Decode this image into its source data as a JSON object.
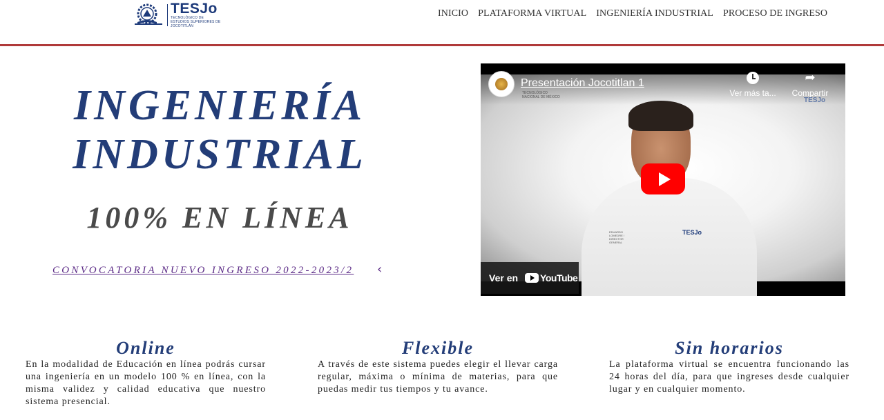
{
  "header": {
    "logo_title": "TESJo",
    "logo_subtitle": "TECNOLÓGICO DE ESTUDIOS SUPERIORES DE JOCOTITLÁN",
    "nav": [
      {
        "label": "INICIO"
      },
      {
        "label": "PLATAFORMA VIRTUAL"
      },
      {
        "label": "INGENIERÍA INDUSTRIAL"
      },
      {
        "label": "PROCESO DE INGRESO"
      }
    ],
    "accent_line_color": "#b03a3a"
  },
  "hero": {
    "title_line1": "INGENIERÍA",
    "title_line2": "INDUSTRIAL",
    "subtitle": "100% EN LÍNEA",
    "cta_label": "CONVOCATORIA NUEVO INGRESO 2022-2023/2",
    "cta_icon": "chevron-left-icon",
    "title_color": "#233d78"
  },
  "video": {
    "title": "Presentación Jocotitlan 1",
    "channel_caption": "TECNOLÓGICO NACIONAL DE MÉXICO",
    "watch_later_label": "Ver más ta...",
    "share_label": "Compartir",
    "watch_on_label": "Ver en",
    "youtube_word": "YouTube",
    "corner_mark": "TESJo",
    "shirt_logo": "TESJo",
    "shirt_name": "EDUARDO LOMEDRE / DIRECTOR GENERAL",
    "play_color": "#ff0000"
  },
  "features": [
    {
      "title": "Online",
      "text": "En la modalidad de Educación en línea podrás cursar una ingeniería en un modelo 100 % en línea, con la misma validez y calidad educativa que nuestro sistema presencial."
    },
    {
      "title": "Flexible",
      "text": "A través de este sistema puedes elegir el llevar carga regular, máxima o mínima de materias, para que puedas medir tus tiempos y tu avance."
    },
    {
      "title": "Sin horarios",
      "text": "La plataforma virtual se encuentra funcionando las 24 horas del día, para que ingreses desde cualquier lugar y en cualquier momento."
    }
  ]
}
